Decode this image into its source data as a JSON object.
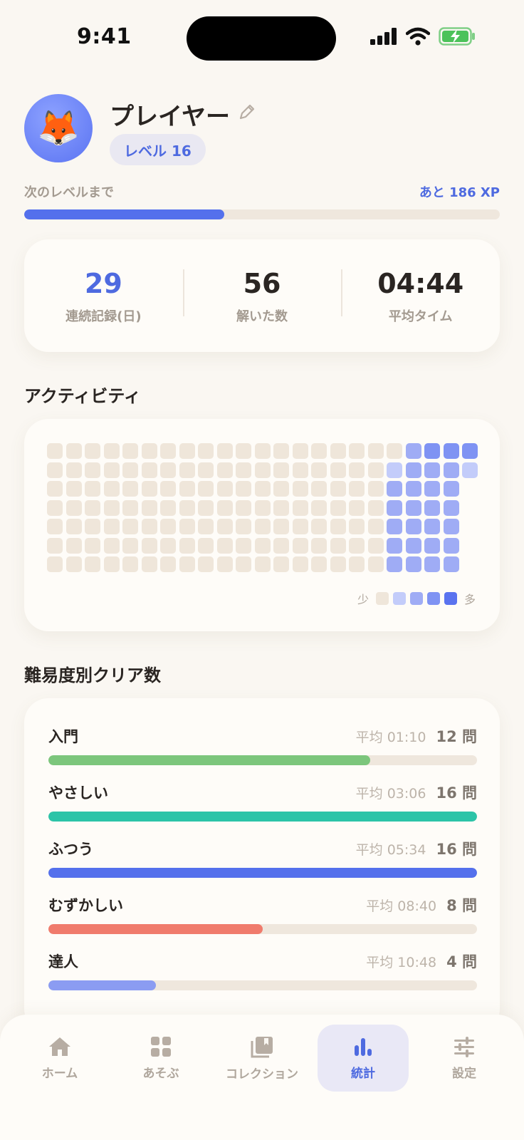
{
  "status_bar": {
    "time": "9:41"
  },
  "profile": {
    "avatar_emoji": "🦊",
    "name": "プレイヤー",
    "level": "レベル 16",
    "xp_label": "次のレベルまで",
    "xp_remaining": "あと 186 XP",
    "xp_progress": 0.42
  },
  "stats": [
    {
      "value": "29",
      "label": "連続記録(日)",
      "accent": true
    },
    {
      "value": "56",
      "label": "解いた数",
      "accent": false
    },
    {
      "value": "04:44",
      "label": "平均タイム",
      "accent": false
    }
  ],
  "activity": {
    "title": "アクティビティ",
    "legend_low": "少",
    "legend_high": "多",
    "levels_colors": [
      "#efe6da",
      "#c3ccfa",
      "#9facf5",
      "#7f93f3",
      "#5a73ef"
    ],
    "weeks": 23,
    "days": 7,
    "grid": [
      [
        0,
        0,
        0,
        0,
        0,
        0,
        0,
        0,
        0,
        0,
        0,
        0,
        0,
        0,
        0,
        0,
        0,
        0,
        0,
        2,
        3,
        3,
        3
      ],
      [
        0,
        0,
        0,
        0,
        0,
        0,
        0,
        0,
        0,
        0,
        0,
        0,
        0,
        0,
        0,
        0,
        0,
        0,
        1,
        2,
        2,
        2,
        1
      ],
      [
        0,
        0,
        0,
        0,
        0,
        0,
        0,
        0,
        0,
        0,
        0,
        0,
        0,
        0,
        0,
        0,
        0,
        0,
        2,
        2,
        2,
        2,
        null
      ],
      [
        0,
        0,
        0,
        0,
        0,
        0,
        0,
        0,
        0,
        0,
        0,
        0,
        0,
        0,
        0,
        0,
        0,
        0,
        2,
        2,
        2,
        2,
        null
      ],
      [
        0,
        0,
        0,
        0,
        0,
        0,
        0,
        0,
        0,
        0,
        0,
        0,
        0,
        0,
        0,
        0,
        0,
        0,
        2,
        2,
        2,
        2,
        null
      ],
      [
        0,
        0,
        0,
        0,
        0,
        0,
        0,
        0,
        0,
        0,
        0,
        0,
        0,
        0,
        0,
        0,
        0,
        0,
        2,
        2,
        2,
        2,
        null
      ],
      [
        0,
        0,
        0,
        0,
        0,
        0,
        0,
        0,
        0,
        0,
        0,
        0,
        0,
        0,
        0,
        0,
        0,
        0,
        2,
        2,
        2,
        2,
        null
      ]
    ]
  },
  "difficulty": {
    "title": "難易度別クリア数",
    "rows": [
      {
        "name": "入門",
        "avg": "平均 01:10",
        "count": "12 問",
        "progress": 0.75,
        "color": "#7cc67c"
      },
      {
        "name": "やさしい",
        "avg": "平均 03:06",
        "count": "16 問",
        "progress": 1.0,
        "color": "#2cc4a8"
      },
      {
        "name": "ふつう",
        "avg": "平均 05:34",
        "count": "16 問",
        "progress": 1.0,
        "color": "#5470ec"
      },
      {
        "name": "むずかしい",
        "avg": "平均 08:40",
        "count": "8 問",
        "progress": 0.5,
        "color": "#f07b6c"
      },
      {
        "name": "達人",
        "avg": "平均 10:48",
        "count": "4 問",
        "progress": 0.25,
        "color": "#8b9cf2"
      }
    ]
  },
  "tabs": [
    {
      "label": "ホーム",
      "icon": "home-icon",
      "active": false
    },
    {
      "label": "あそぶ",
      "icon": "grid-icon",
      "active": false
    },
    {
      "label": "コレクション",
      "icon": "collection-icon",
      "active": false
    },
    {
      "label": "統計",
      "icon": "stats-icon",
      "active": true
    },
    {
      "label": "設定",
      "icon": "sliders-icon",
      "active": false
    }
  ]
}
